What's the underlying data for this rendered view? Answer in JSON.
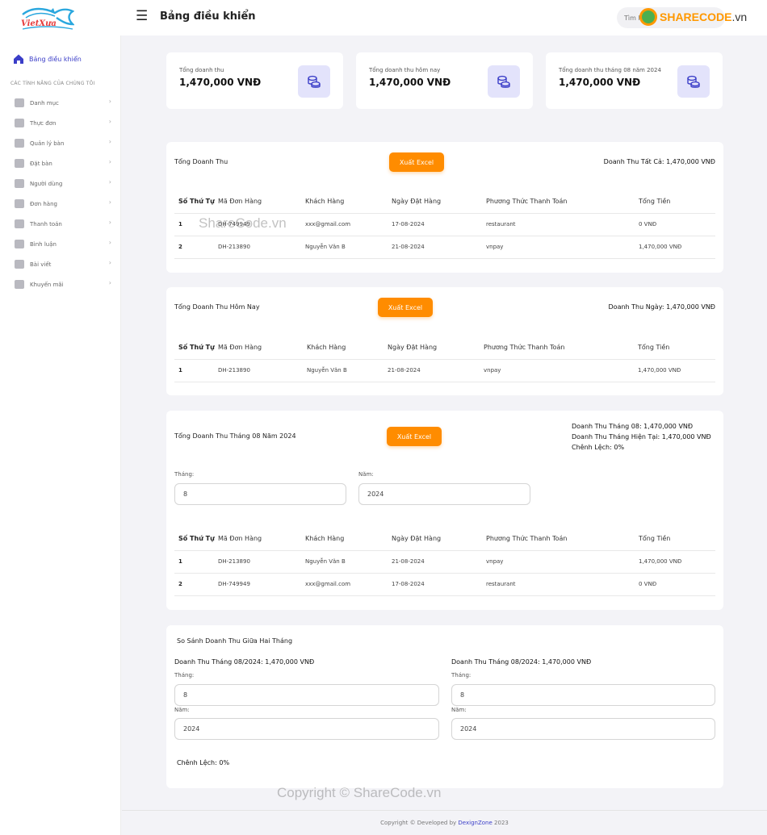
{
  "header": {
    "logo_text": "VietXưa",
    "page_title": "Bảng điều khiển",
    "search_placeholder": "Tìm kiếm",
    "watermark_logo": "SHARECODE",
    "watermark_logo_suffix": ".vn"
  },
  "sidebar": {
    "active_label": "Bảng điều khiển",
    "section_heading": "CÁC TÍNH NĂNG CỦA CHÚNG TÔI",
    "items": [
      {
        "label": "Danh mục"
      },
      {
        "label": "Thực đơn"
      },
      {
        "label": "Quản lý bàn"
      },
      {
        "label": "Đặt bàn"
      },
      {
        "label": "Người dùng"
      },
      {
        "label": "Đơn hàng"
      },
      {
        "label": "Thanh toán"
      },
      {
        "label": "Bình luận"
      },
      {
        "label": "Bài viết"
      },
      {
        "label": "Khuyến mãi"
      }
    ],
    "chevron": "›"
  },
  "stats": [
    {
      "label": "Tổng doanh thu",
      "value": "1,470,000 VNĐ"
    },
    {
      "label": "Tổng doanh thu hôm nay",
      "value": "1,470,000 VNĐ"
    },
    {
      "label": "Tổng doanh thu tháng 08 năm 2024",
      "value": "1,470,000 VNĐ"
    }
  ],
  "columns": [
    "Số Thứ Tự",
    "Mã Đơn Hàng",
    "Khách Hàng",
    "Ngày Đặt Hàng",
    "Phương Thức Thanh Toán",
    "Tổng Tiền"
  ],
  "excel_label": "Xuất Excel",
  "panel_total": {
    "title": "Tổng Doanh Thu",
    "summary": "Doanh Thu Tất Cả: 1,470,000 VNĐ",
    "rows": [
      [
        "1",
        "DH-749949",
        "xxx@gmail.com",
        "17-08-2024",
        "restaurant",
        "0 VNĐ"
      ],
      [
        "2",
        "DH-213890",
        "Nguyễn Văn B",
        "21-08-2024",
        "vnpay",
        "1,470,000 VNĐ"
      ]
    ]
  },
  "panel_today": {
    "title": "Tổng Doanh Thu Hôm Nay",
    "summary": "Doanh Thu Ngày: 1,470,000 VNĐ",
    "rows": [
      [
        "1",
        "DH-213890",
        "Nguyễn Văn B",
        "21-08-2024",
        "vnpay",
        "1,470,000 VNĐ"
      ]
    ]
  },
  "panel_month": {
    "title": "Tổng Doanh Thu Tháng 08 Năm 2024",
    "summary_lines": [
      "Doanh Thu Tháng 08: 1,470,000 VNĐ",
      "Doanh Thu Tháng Hiện Tại: 1,470,000 VNĐ",
      "Chênh Lệch: 0%"
    ],
    "month_label": "Tháng:",
    "month_value": "8",
    "year_label": "Năm:",
    "year_value": "2024",
    "rows": [
      [
        "1",
        "DH-213890",
        "Nguyễn Văn B",
        "21-08-2024",
        "vnpay",
        "1,470,000 VNĐ"
      ],
      [
        "2",
        "DH-749949",
        "xxx@gmail.com",
        "17-08-2024",
        "restaurant",
        "0 VNĐ"
      ]
    ]
  },
  "compare": {
    "title": "So Sánh Doanh Thu Giữa Hai Tháng",
    "left": {
      "heading": "Doanh Thu Tháng 08/2024: 1,470,000 VNĐ",
      "month_label": "Tháng:",
      "month_value": "8",
      "year_label": "Năm:",
      "year_value": "2024"
    },
    "right": {
      "heading": "Doanh Thu Tháng 08/2024: 1,470,000 VNĐ",
      "month_label": "Tháng:",
      "month_value": "8",
      "year_label": "Năm:",
      "year_value": "2024"
    },
    "difference": "Chênh Lệch: 0%"
  },
  "footer": {
    "prefix": "Copyright © Developed by",
    "brand": "DexignZone",
    "year": "2023"
  },
  "watermarks": {
    "top": "ShareCode.vn",
    "bottom": "Copyright © ShareCode.vn"
  },
  "colors": {
    "accent": "#3b3ec8",
    "excel_button": "#ff8c00",
    "icon_badge": "#e3e3fb"
  }
}
